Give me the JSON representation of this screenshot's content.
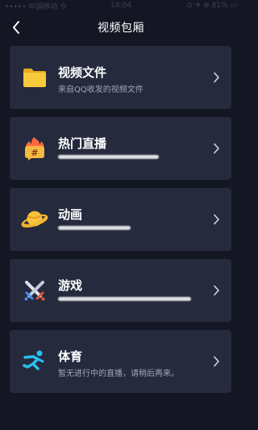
{
  "status_bar": {
    "left": "••••• 中国移动 令",
    "time": "18:04",
    "right": "⊙ ✈ ⊕ 81% ▭"
  },
  "header": {
    "title": "视频包厢"
  },
  "cards": [
    {
      "title": "视频文件",
      "subtitle": "来自QQ收发的视频文件",
      "icon": "folder-icon"
    },
    {
      "title": "热门直播",
      "subtitle": "",
      "icon": "hot-live-icon"
    },
    {
      "title": "动画",
      "subtitle": "",
      "icon": "planet-icon"
    },
    {
      "title": "游戏",
      "subtitle": "",
      "icon": "crossed-swords-icon"
    },
    {
      "title": "体育",
      "subtitle": "暂无进行中的直播，请稍后再来。",
      "icon": "runner-icon"
    }
  ],
  "colors": {
    "background": "#141624",
    "card": "#262a3d",
    "subtitle": "#a2a5b3",
    "folder": "#f5c233",
    "accent_blue": "#29c0f0"
  }
}
